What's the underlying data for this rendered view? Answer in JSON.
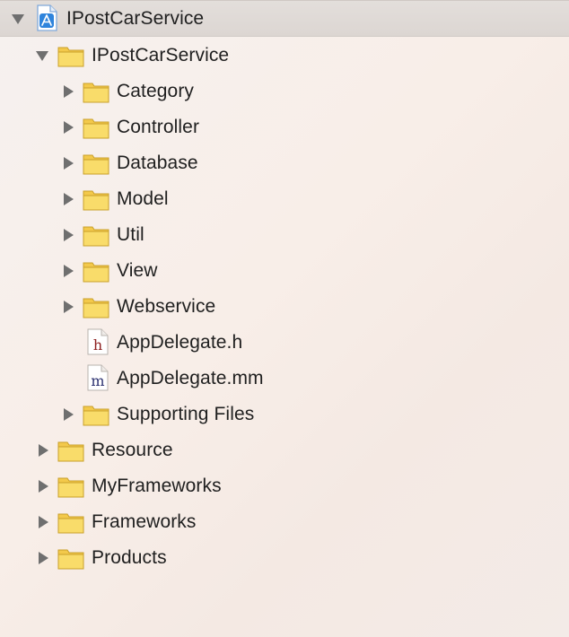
{
  "navigator": {
    "project": {
      "label": "IPostCarService",
      "icon": "xcode-project-icon",
      "expanded": true
    },
    "items": [
      {
        "label": "IPostCarService",
        "type": "folder",
        "expanded": true
      },
      {
        "label": "Category",
        "type": "folder",
        "expanded": false
      },
      {
        "label": "Controller",
        "type": "folder",
        "expanded": false
      },
      {
        "label": "Database",
        "type": "folder",
        "expanded": false
      },
      {
        "label": "Model",
        "type": "folder",
        "expanded": false
      },
      {
        "label": "Util",
        "type": "folder",
        "expanded": false
      },
      {
        "label": "View",
        "type": "folder",
        "expanded": false
      },
      {
        "label": "Webservice",
        "type": "folder",
        "expanded": false
      },
      {
        "label": "AppDelegate.h",
        "type": "header-file",
        "glyph": "h"
      },
      {
        "label": "AppDelegate.mm",
        "type": "source-file",
        "glyph": "m"
      },
      {
        "label": "Supporting Files",
        "type": "folder",
        "expanded": false
      },
      {
        "label": "Resource",
        "type": "folder",
        "expanded": false
      },
      {
        "label": "MyFrameworks",
        "type": "folder",
        "expanded": false
      },
      {
        "label": "Frameworks",
        "type": "folder",
        "expanded": false
      },
      {
        "label": "Products",
        "type": "folder",
        "expanded": false
      }
    ]
  },
  "colors": {
    "folder_fill": "#f7d65f",
    "folder_stroke": "#cfa52c",
    "header_glyph": "#8d1f1f",
    "source_glyph": "#2c3170",
    "project_blue": "#2f84dc",
    "disclosure": "#6f6f6f",
    "text": "#1f1f1f",
    "selection": "#ddd7d3"
  }
}
